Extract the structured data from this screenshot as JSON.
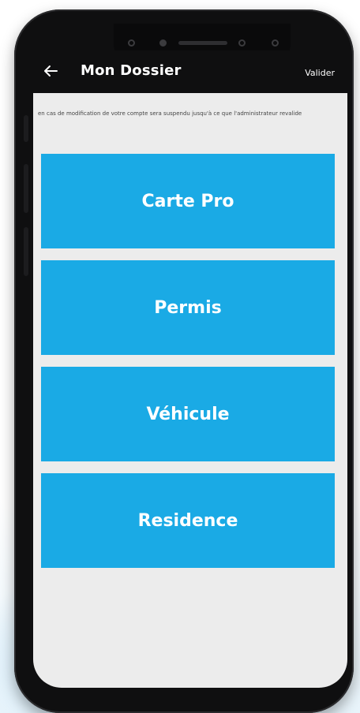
{
  "app": {
    "title": "Mon Dossier",
    "validate_label": "Valider",
    "notice": "en cas de modification de votre compte sera suspendu jusqu'à ce que l'administrateur revalide"
  },
  "menu": {
    "items": [
      {
        "label": "Carte Pro"
      },
      {
        "label": "Permis"
      },
      {
        "label": "Véhicule"
      },
      {
        "label": "Residence"
      }
    ]
  },
  "icons": {
    "back": "arrow-left-icon"
  },
  "colors": {
    "accent": "#1aaae5",
    "appbar": "#0f0f10",
    "screen_bg": "#ececec"
  }
}
